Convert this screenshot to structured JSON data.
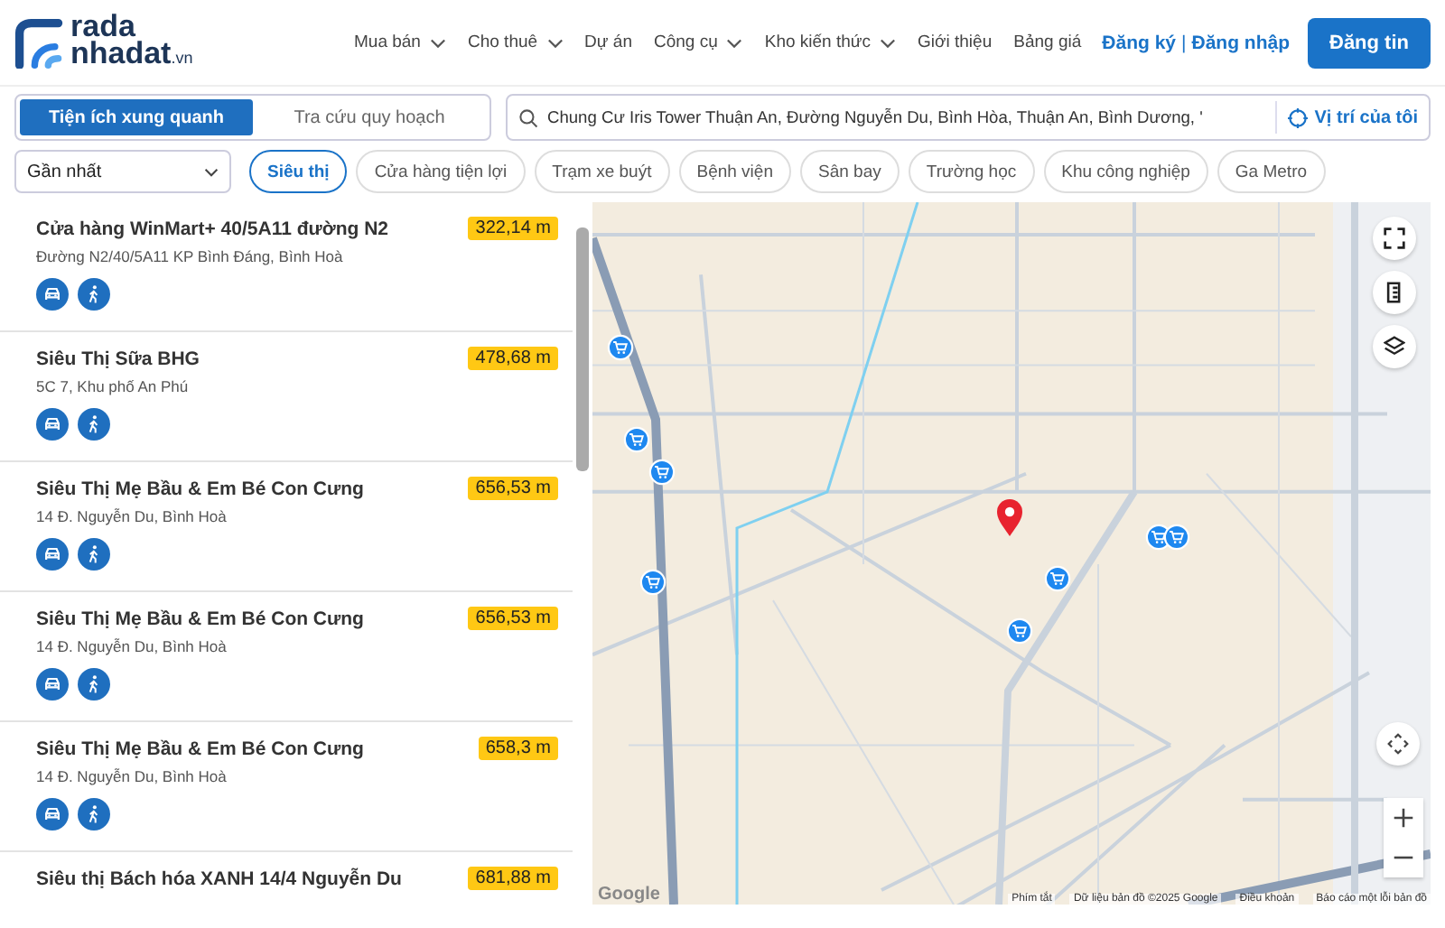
{
  "logo": {
    "line1": "rada",
    "line2": "nhadat",
    "suffix": ".vn"
  },
  "nav": [
    {
      "label": "Mua bán",
      "has_menu": true
    },
    {
      "label": "Cho thuê",
      "has_menu": true
    },
    {
      "label": "Dự án",
      "has_menu": false
    },
    {
      "label": "Công cụ",
      "has_menu": true
    },
    {
      "label": "Kho kiến thức",
      "has_menu": true
    },
    {
      "label": "Giới thiệu",
      "has_menu": false
    },
    {
      "label": "Bảng giá",
      "has_menu": false
    }
  ],
  "auth": {
    "register": "Đăng ký",
    "separator": "|",
    "login": "Đăng nhập"
  },
  "post_button": "Đăng tin",
  "mode_tabs": [
    {
      "label": "Tiện ích xung quanh",
      "selected": true
    },
    {
      "label": "Tra cứu quy hoạch",
      "selected": false
    }
  ],
  "search": {
    "value": "Chung Cư Iris Tower Thuận An, Đường Nguyễn Du, Bình Hòa, Thuận An, Bình Dương, '"
  },
  "locate_button": "Vị trí của tôi",
  "sort": {
    "value": "Gần nhất"
  },
  "categories": [
    {
      "label": "Siêu thị",
      "selected": true
    },
    {
      "label": "Cửa hàng tiện lợi",
      "selected": false
    },
    {
      "label": "Trạm xe buýt",
      "selected": false
    },
    {
      "label": "Bệnh viện",
      "selected": false
    },
    {
      "label": "Sân bay",
      "selected": false
    },
    {
      "label": "Trường học",
      "selected": false
    },
    {
      "label": "Khu công nghiệp",
      "selected": false
    },
    {
      "label": "Ga Metro",
      "selected": false
    }
  ],
  "places": [
    {
      "name": "Cửa hàng WinMart+ 40/5A11 đường N2",
      "address": "Đường N2/40/5A11 KP Bình Đáng, Bình Hoà",
      "distance": "322,14 m"
    },
    {
      "name": "Siêu Thị Sữa BHG",
      "address": "5C 7, Khu phố An Phú",
      "distance": "478,68 m"
    },
    {
      "name": "Siêu Thị Mẹ Bầu & Em Bé Con Cưng",
      "address": "14 Đ. Nguyễn Du, Bình Hoà",
      "distance": "656,53 m"
    },
    {
      "name": "Siêu Thị Mẹ Bầu & Em Bé Con Cưng",
      "address": "14 Đ. Nguyễn Du, Bình Hoà",
      "distance": "656,53 m"
    },
    {
      "name": "Siêu Thị Mẹ Bầu & Em Bé Con Cưng",
      "address": "14 Đ. Nguyễn Du, Bình Hoà",
      "distance": "658,3 m"
    },
    {
      "name": "Siêu thị Bách hóa XANH 14/4 Nguyễn Du",
      "distance": "681,88 m"
    }
  ],
  "map": {
    "attribution": [
      {
        "kind": "logo",
        "text": "Google"
      },
      {
        "kind": "link",
        "text": "Phím tắt"
      },
      {
        "kind": "link",
        "text": "Dữ liệu bản đồ ©2025 Google"
      },
      {
        "kind": "link",
        "text": "Điều khoản"
      },
      {
        "kind": "link",
        "text": "Báo cáo một lỗi bản đồ"
      }
    ]
  }
}
